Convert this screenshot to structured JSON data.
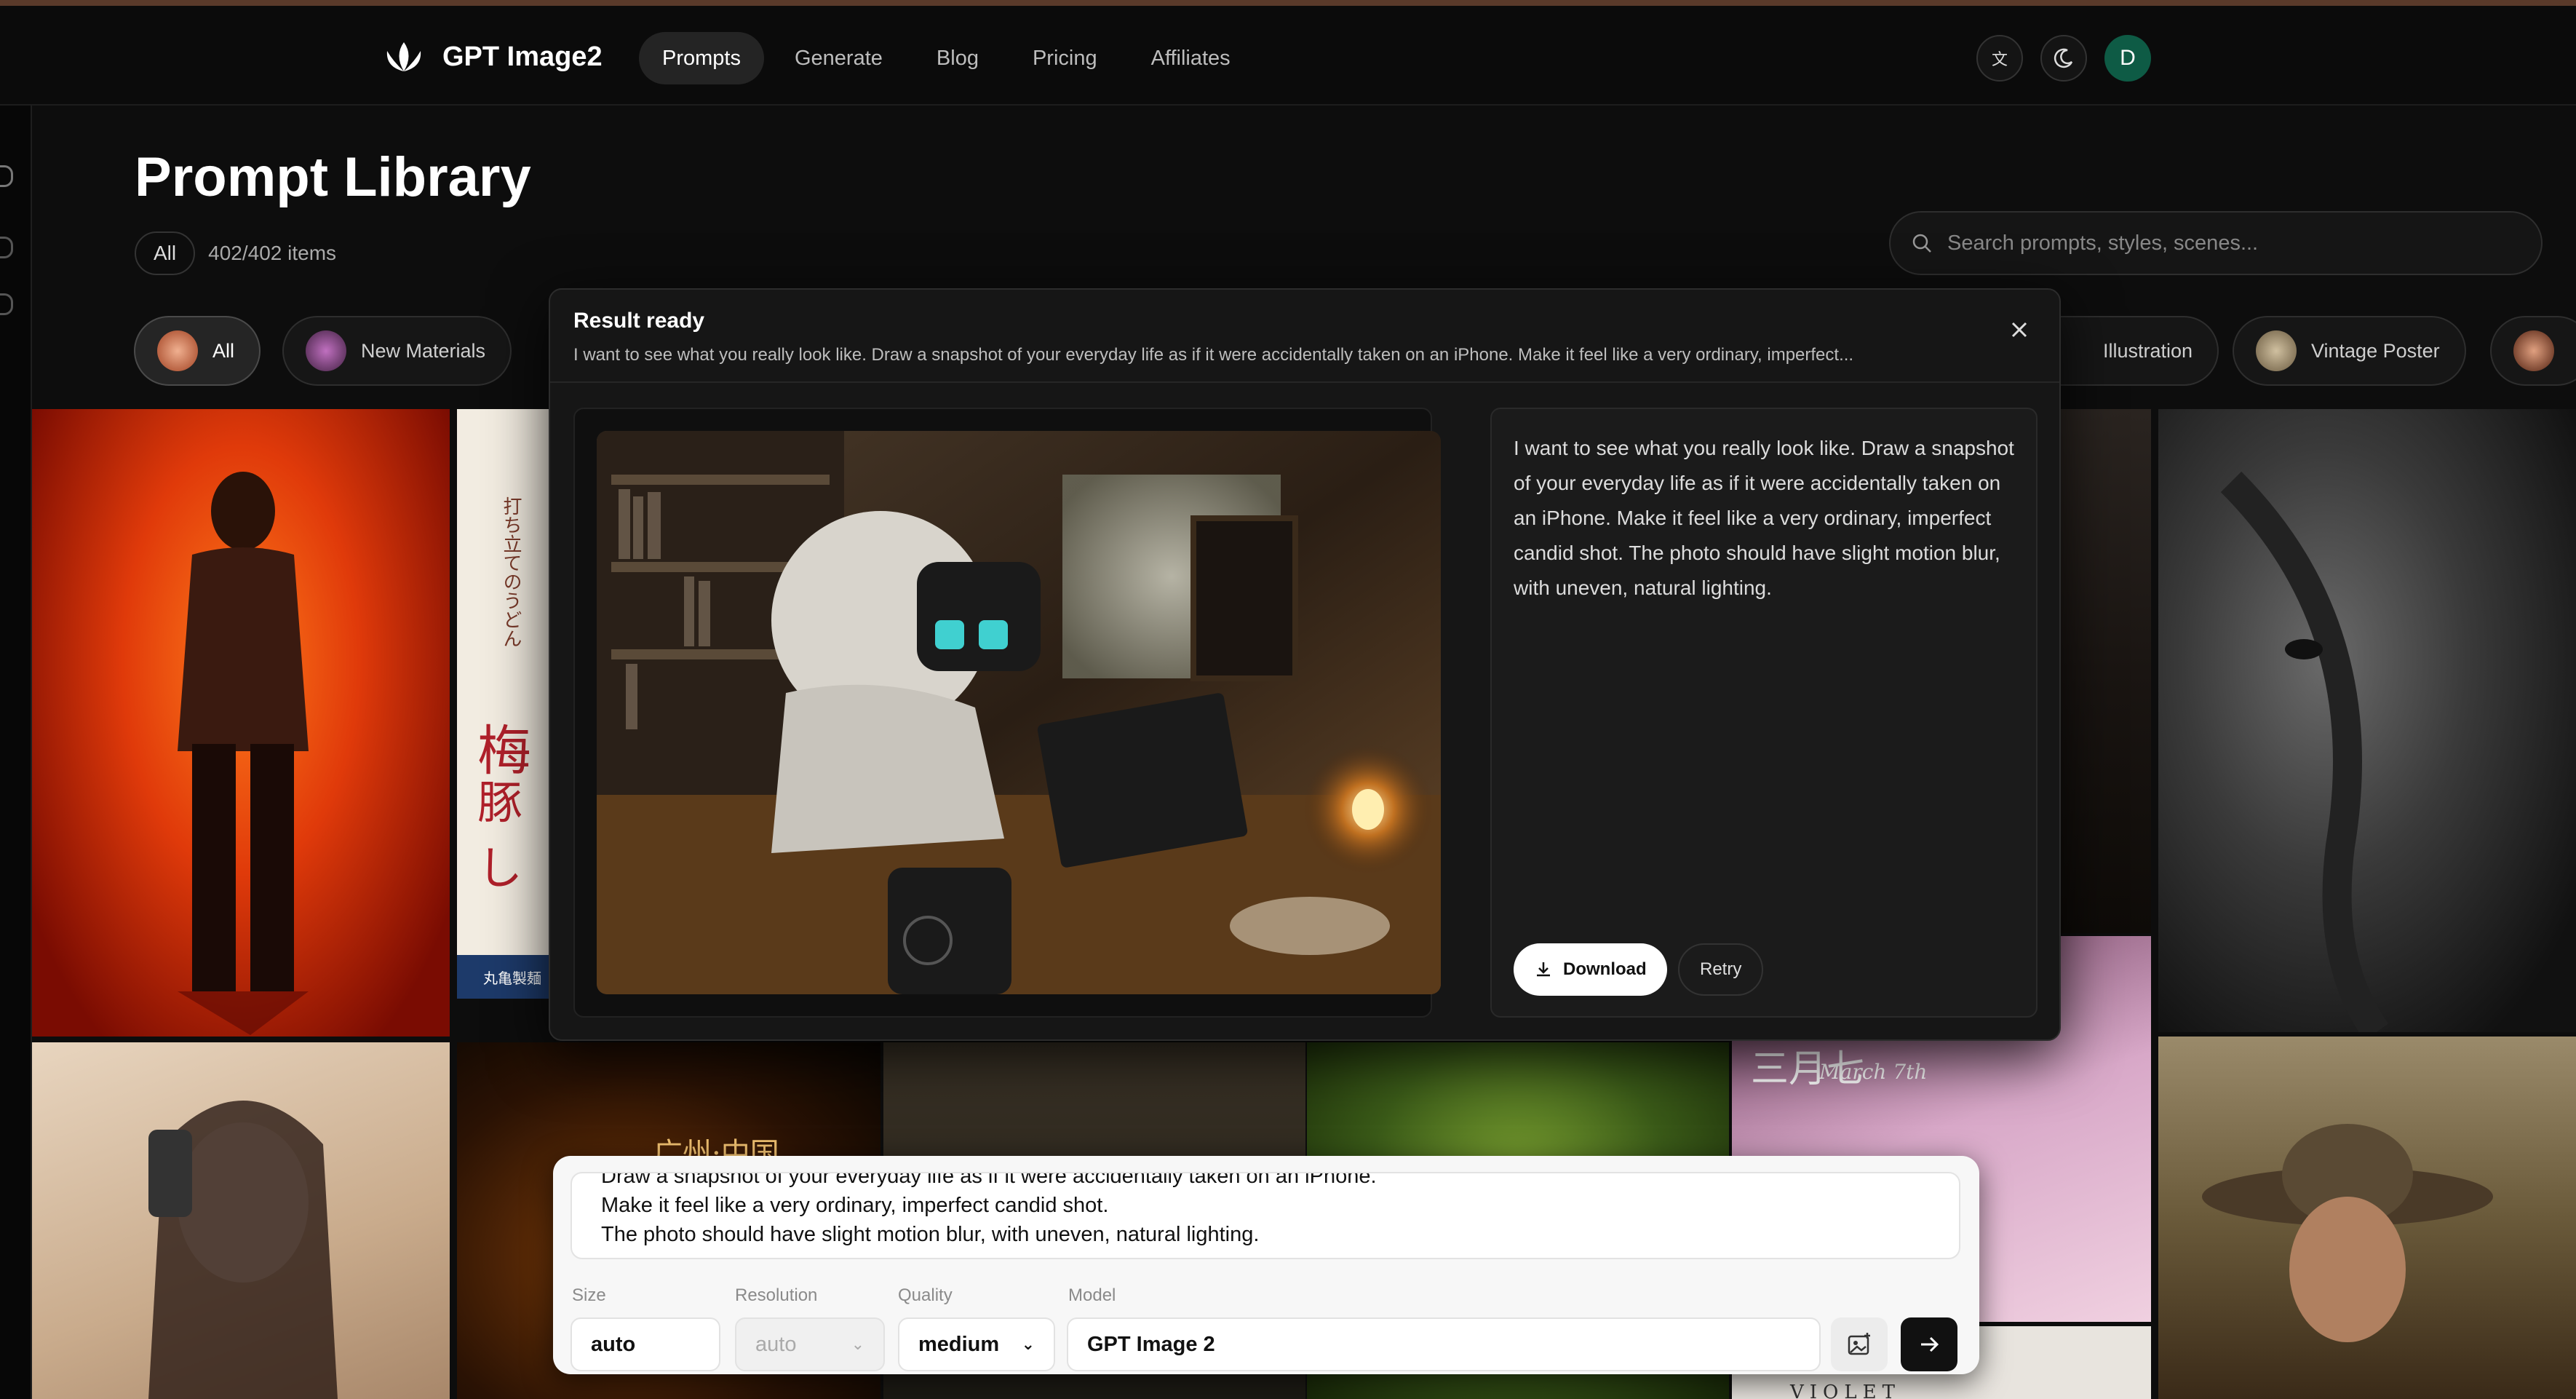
{
  "header": {
    "brand": "GPT Image2",
    "nav": [
      "Prompts",
      "Generate",
      "Blog",
      "Pricing",
      "Affiliates"
    ],
    "avatar_initial": "D"
  },
  "library": {
    "title": "Prompt Library",
    "filter_chip": "All",
    "count": "402/402 items",
    "search_placeholder": "Search prompts, styles, scenes..."
  },
  "categories": [
    {
      "label": "All",
      "active": true
    },
    {
      "label": "New Materials",
      "active": false
    },
    {
      "label": "Illustration",
      "active": false
    },
    {
      "label": "Vintage Poster",
      "active": false
    }
  ],
  "modal": {
    "title": "Result ready",
    "subtitle": "I want to see what you really look like. Draw a snapshot of your everyday life as if it were accidentally taken on an iPhone. Make it feel like a very ordinary, imperfect...",
    "prompt": "I want to see what you really look like. Draw a snapshot of your everyday life as if it were accidentally taken on an iPhone. Make it feel like a very ordinary, imperfect candid shot. The photo should have slight motion blur, with uneven, natural lighting.",
    "download_label": "Download",
    "retry_label": "Retry"
  },
  "composer": {
    "lines": [
      "Draw a snapshot of your everyday life as if it were accidentally taken on an iPhone.",
      "Make it feel like a very ordinary, imperfect candid shot.",
      "The photo should have slight motion blur, with uneven, natural lighting."
    ],
    "size_label": "Size",
    "size_value": "auto",
    "resolution_label": "Resolution",
    "resolution_value": "auto",
    "quality_label": "Quality",
    "quality_value": "medium",
    "model_label": "Model",
    "model_value": "GPT Image 2"
  },
  "tile_text": {
    "poster_jp_vertical": "打ち立てのうどん",
    "poster_jp_title": "梅",
    "poster_jp_title2": "豚し",
    "poster_jp_footer": "丸亀製麺",
    "poster_cn": "广州·中国",
    "poster_march": "三月七",
    "poster_march_script": "March 7th",
    "poster_violet": "VIOLET"
  },
  "colors": {
    "accent_avatar": "#0e5b45",
    "background": "#0d0d0d"
  }
}
